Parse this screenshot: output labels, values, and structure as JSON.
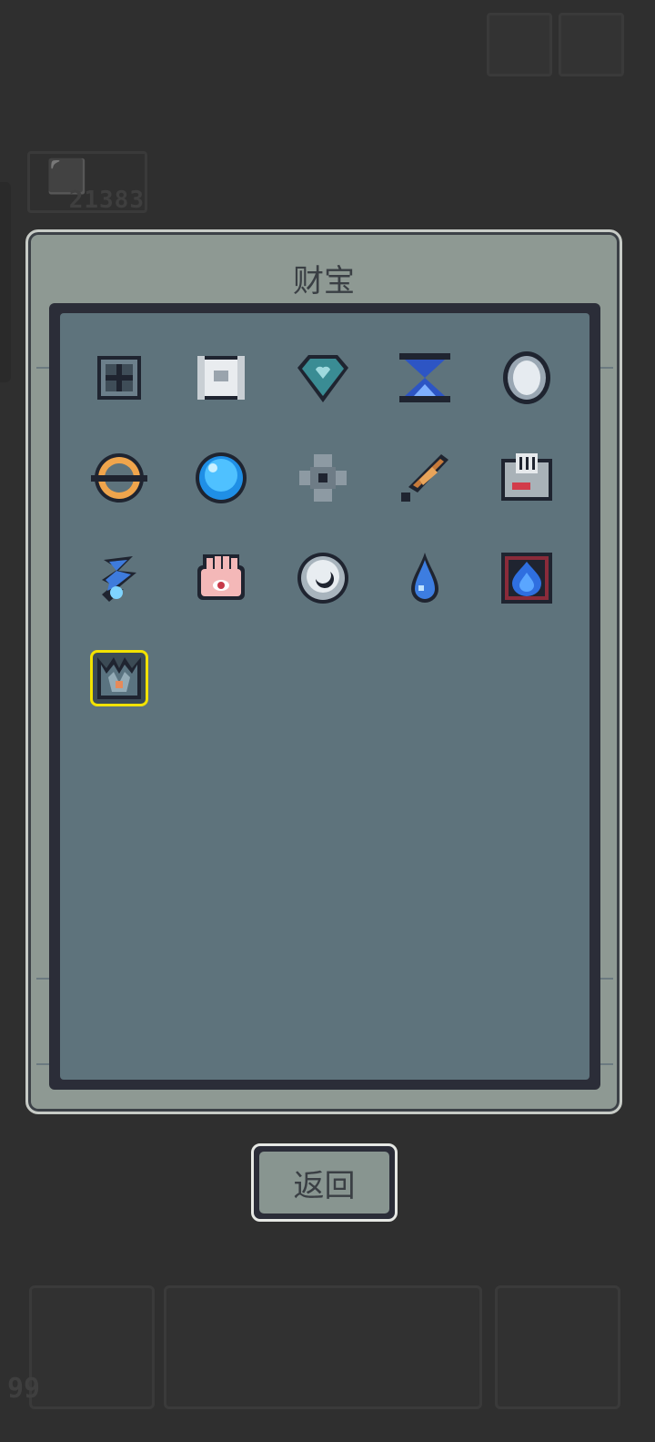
{
  "background": {
    "gold_amount": "21383",
    "item_count": "99"
  },
  "dialog": {
    "title": "财宝",
    "return_label": "返回",
    "treasures": [
      {
        "icon": "iron-crate-icon"
      },
      {
        "icon": "paper-scroll-icon"
      },
      {
        "icon": "heart-gem-icon"
      },
      {
        "icon": "hourglass-icon"
      },
      {
        "icon": "mirror-icon"
      },
      {
        "icon": "orange-ring-icon"
      },
      {
        "icon": "blue-orb-icon"
      },
      {
        "icon": "stone-gear-icon"
      },
      {
        "icon": "feather-quill-icon"
      },
      {
        "icon": "ticket-box-icon"
      },
      {
        "icon": "spirit-wisp-icon"
      },
      {
        "icon": "eye-palm-icon"
      },
      {
        "icon": "moon-stone-icon"
      },
      {
        "icon": "water-drop-icon"
      },
      {
        "icon": "blue-flame-frame-icon"
      },
      {
        "icon": "crown-claw-icon",
        "selected": true
      }
    ]
  },
  "colors": {
    "selected_outline": "#f2e200",
    "panel": "#8e9993",
    "inner": "#5e737c"
  }
}
